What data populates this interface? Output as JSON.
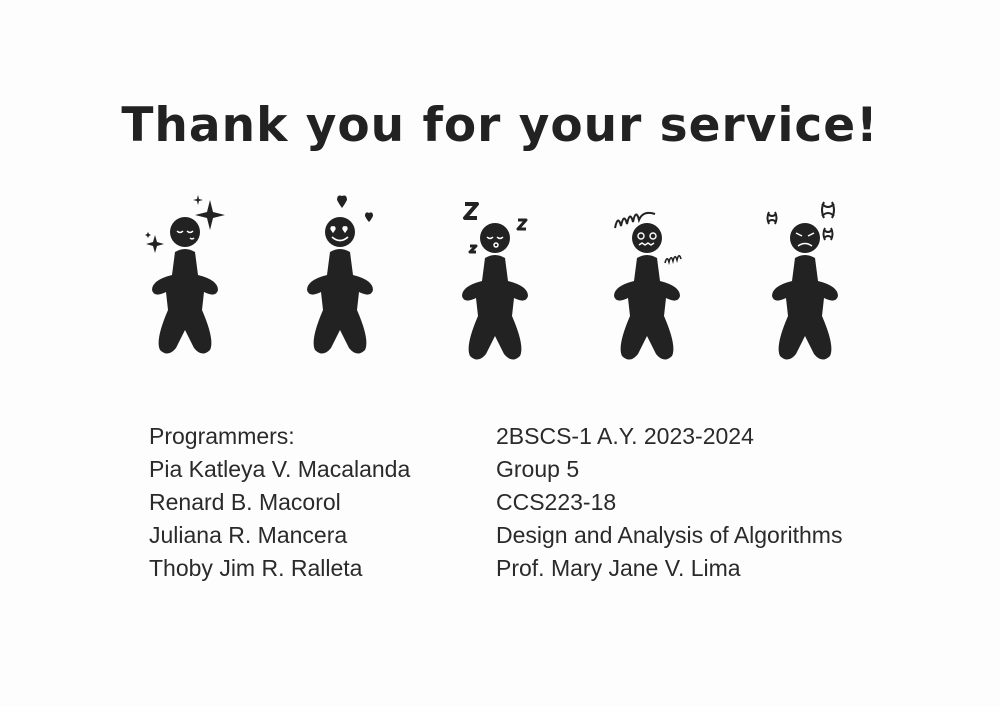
{
  "slide": {
    "title": "Thank you for your service!"
  },
  "figures": [
    {
      "name": "figure-sparkle",
      "icon": "sparkle-person-icon"
    },
    {
      "name": "figure-love",
      "icon": "heart-eyes-person-icon"
    },
    {
      "name": "figure-sleepy",
      "icon": "sleeping-person-icon"
    },
    {
      "name": "figure-dizzy",
      "icon": "dizzy-person-icon"
    },
    {
      "name": "figure-angry",
      "icon": "angry-person-icon"
    }
  ],
  "credits": {
    "left": [
      "Programmers:",
      "Pia Katleya V. Macalanda",
      "Renard B. Macorol",
      "Juliana R. Mancera",
      "Thoby Jim R. Ralleta"
    ],
    "right": [
      "2BSCS-1 A.Y. 2023-2024",
      "Group 5",
      "CCS223-18",
      "Design and Analysis of Algorithms",
      "Prof. Mary Jane V. Lima"
    ]
  },
  "colors": {
    "ink": "#222222",
    "background": "#fdfdfd"
  }
}
